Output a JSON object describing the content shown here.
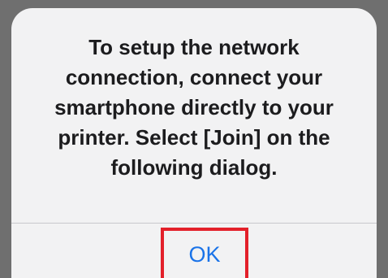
{
  "dialog": {
    "message": "To setup the network\nconnection, connect your\nsmartphone directly to your\nprinter. Select [Join] on the\nfollowing dialog.",
    "ok_label": "OK"
  },
  "colors": {
    "dialog_background": "#f2f2f3",
    "text": "#1c1c1e",
    "button_text": "#1a73e8",
    "highlight_border": "#e3202a",
    "divider": "#c8c8cc"
  }
}
